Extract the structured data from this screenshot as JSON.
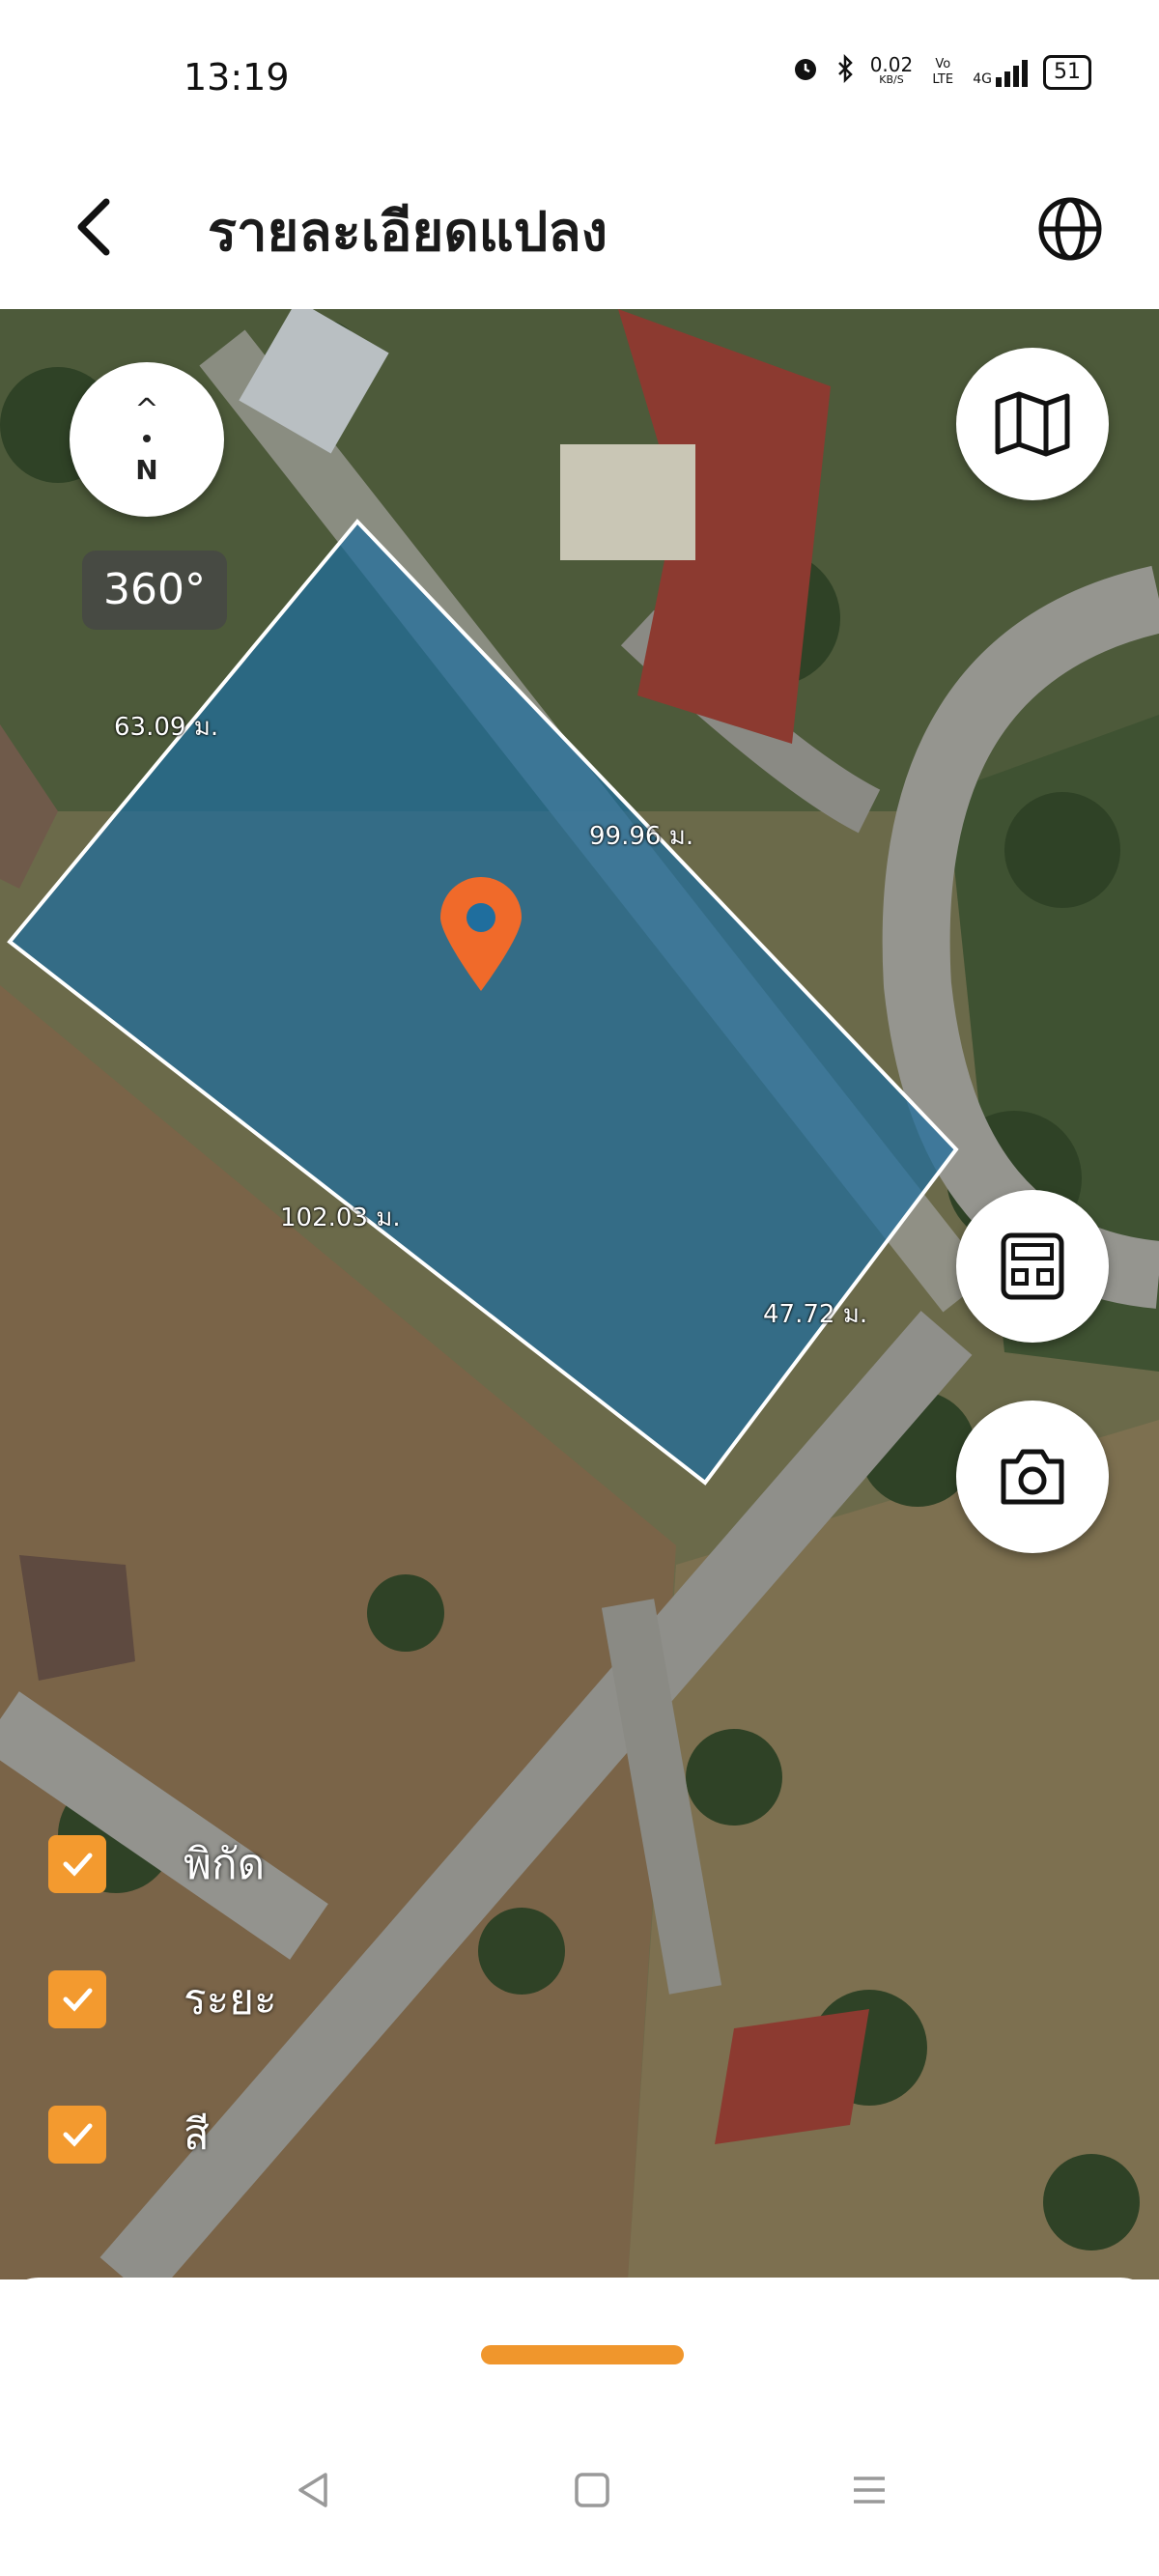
{
  "status_bar": {
    "time": "13:19",
    "net_speed_value": "0.02",
    "net_speed_unit": "KB/S",
    "volte": "Vo LTE",
    "network": "4G",
    "battery": "51"
  },
  "header": {
    "title": "รายละเอียดแปลง",
    "back_icon": "chevron-left-icon",
    "globe_icon": "globe-icon"
  },
  "map": {
    "compass_label": "N",
    "rotation_label": "360°",
    "parcel_color": "#1f6e9e",
    "pin_color": "#f06a2a",
    "dimensions": {
      "top_left_side": "63.09 ม.",
      "top_right_side": "99.96 ม.",
      "bottom_left_side": "102.03 ม.",
      "bottom_right_side": "47.72 ม."
    },
    "buttons": {
      "map_type_icon": "map-icon",
      "calculator_icon": "calculator-icon",
      "camera_icon": "camera-icon"
    },
    "legend": [
      {
        "label": "พิกัด",
        "checked": true
      },
      {
        "label": "ระยะ",
        "checked": true
      },
      {
        "label": "สี",
        "checked": true
      }
    ]
  },
  "colors": {
    "accent": "#f39a2f",
    "handle": "#f0962c"
  },
  "nav_bar": {
    "back_icon": "triangle-back-icon",
    "home_icon": "square-home-icon",
    "menu_icon": "menu-lines-icon"
  }
}
